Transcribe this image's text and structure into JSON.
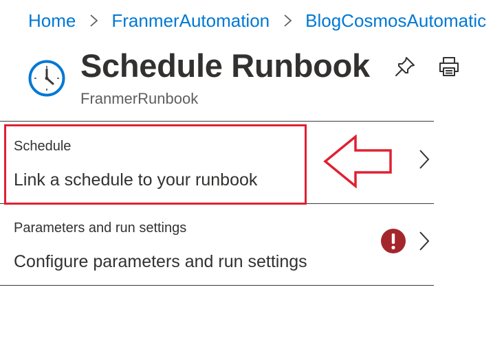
{
  "breadcrumb": [
    {
      "label": "Home"
    },
    {
      "label": "FranmerAutomation"
    },
    {
      "label": "BlogCosmosAutomatic"
    }
  ],
  "header": {
    "icon": "clock-icon",
    "title": "Schedule Runbook",
    "subtitle": "FranmerRunbook",
    "actions": [
      {
        "icon": "pin-icon"
      },
      {
        "icon": "print-icon"
      }
    ]
  },
  "rows": [
    {
      "label": "Schedule",
      "value": "Link a schedule to your runbook",
      "status_icon": null,
      "highlighted": true
    },
    {
      "label": "Parameters and run settings",
      "value": "Configure parameters and run settings",
      "status_icon": "error-icon"
    }
  ],
  "colors": {
    "link": "#0078d4",
    "clock": "#0078d4",
    "error": "#a4262c",
    "annotation": "#e02030",
    "text": "#323130"
  }
}
